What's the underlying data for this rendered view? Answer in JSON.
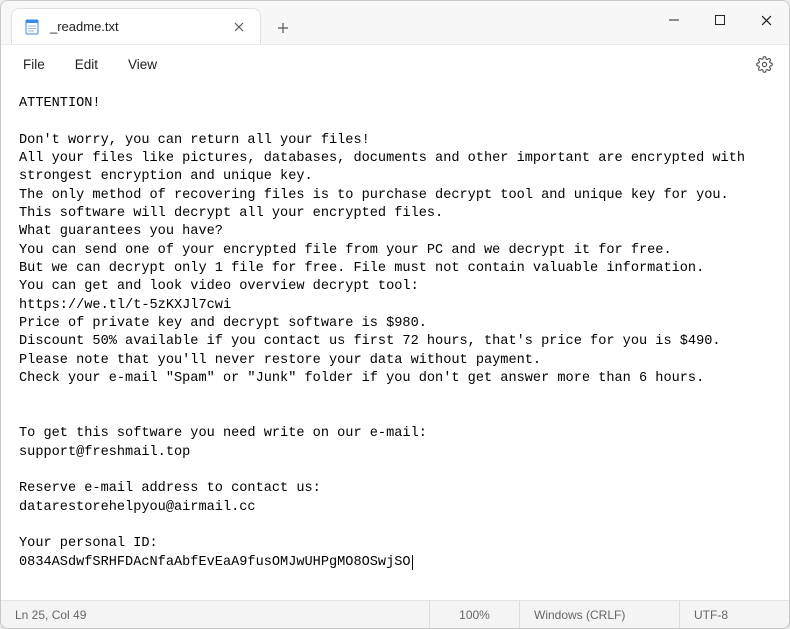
{
  "titlebar": {
    "tab_title": "_readme.txt"
  },
  "menu": {
    "file": "File",
    "edit": "Edit",
    "view": "View"
  },
  "body": {
    "text": "ATTENTION!\n\nDon't worry, you can return all your files!\nAll your files like pictures, databases, documents and other important are encrypted with strongest encryption and unique key.\nThe only method of recovering files is to purchase decrypt tool and unique key for you.\nThis software will decrypt all your encrypted files.\nWhat guarantees you have?\nYou can send one of your encrypted file from your PC and we decrypt it for free.\nBut we can decrypt only 1 file for free. File must not contain valuable information.\nYou can get and look video overview decrypt tool:\nhttps://we.tl/t-5zKXJl7cwi\nPrice of private key and decrypt software is $980.\nDiscount 50% available if you contact us first 72 hours, that's price for you is $490.\nPlease note that you'll never restore your data without payment.\nCheck your e-mail \"Spam\" or \"Junk\" folder if you don't get answer more than 6 hours.\n\n\nTo get this software you need write on our e-mail:\nsupport@freshmail.top\n\nReserve e-mail address to contact us:\ndatarestorehelpyou@airmail.cc\n\nYour personal ID:\n0834ASdwfSRHFDAcNfaAbfEvEaA9fusOMJwUHPgMO8OSwjSO"
  },
  "status": {
    "position": "Ln 25, Col 49",
    "zoom": "100%",
    "eol": "Windows (CRLF)",
    "encoding": "UTF-8"
  }
}
